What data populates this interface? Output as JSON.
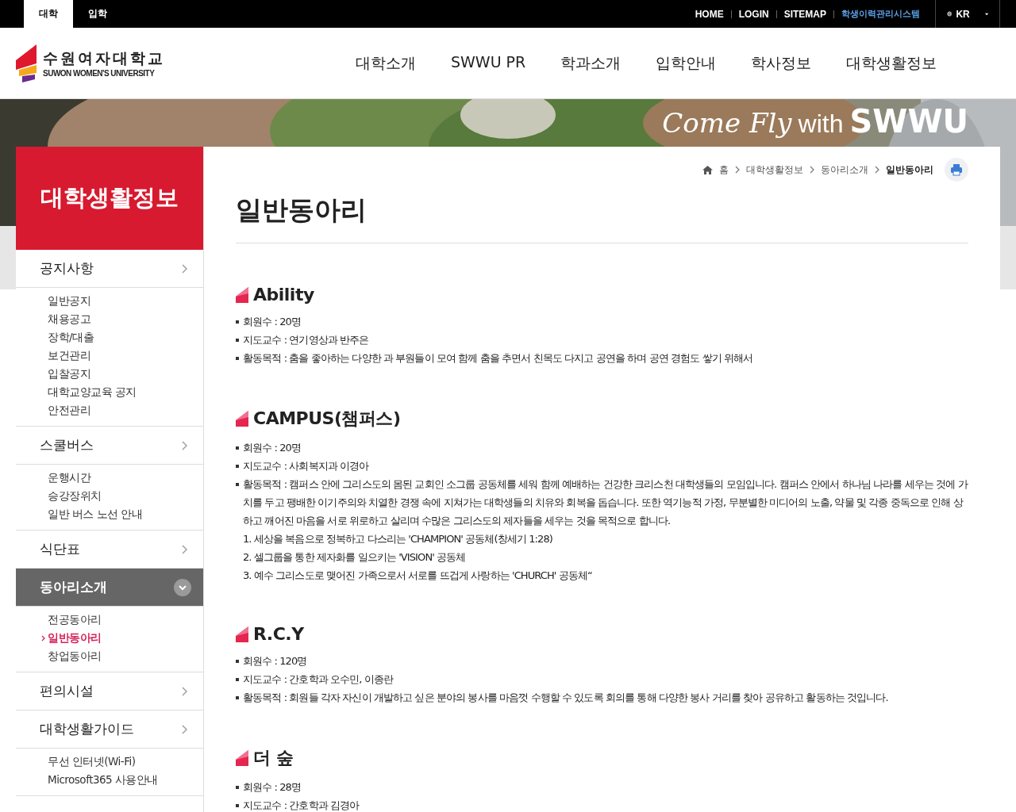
{
  "top_bar": {
    "site_tabs": [
      {
        "label": "대학",
        "selected": true
      },
      {
        "label": "입학",
        "selected": false
      }
    ],
    "links": [
      {
        "label": "HOME",
        "kind": "plain"
      },
      {
        "label": "LOGIN",
        "kind": "plain"
      },
      {
        "label": "SITEMAP",
        "kind": "plain"
      },
      {
        "label": "학생이력관리시스템",
        "kind": "highlight"
      }
    ],
    "language": "KR"
  },
  "header": {
    "logo_korean": "수원여자대학교",
    "logo_english": "SUWON WOMEN'S UNIVERSITY",
    "nav": [
      "대학소개",
      "SWWU PR",
      "학과소개",
      "입학안내",
      "학사정보",
      "대학생활정보"
    ]
  },
  "banner": {
    "slogan_script": "Come Fly",
    "slogan_with": "with",
    "slogan_bold": "SWWU"
  },
  "sidebar": {
    "title": "대학생활정보",
    "groups": [
      {
        "label": "공지사항",
        "selected": false,
        "children": [
          {
            "label": "일반공지",
            "selected": false
          },
          {
            "label": "채용공고",
            "selected": false
          },
          {
            "label": "장학/대출",
            "selected": false
          },
          {
            "label": "보건관리",
            "selected": false
          },
          {
            "label": "입찰공지",
            "selected": false
          },
          {
            "label": "대학교양교육 공지",
            "selected": false
          },
          {
            "label": "안전관리",
            "selected": false
          }
        ]
      },
      {
        "label": "스쿨버스",
        "selected": false,
        "children": [
          {
            "label": "운행시간",
            "selected": false
          },
          {
            "label": "승강장위치",
            "selected": false
          },
          {
            "label": "일반 버스 노선 안내",
            "selected": false
          }
        ]
      },
      {
        "label": "식단표",
        "selected": false
      },
      {
        "label": "동아리소개",
        "selected": true,
        "children": [
          {
            "label": "전공동아리",
            "selected": false
          },
          {
            "label": "일반동아리",
            "selected": true
          },
          {
            "label": "창업동아리",
            "selected": false
          }
        ]
      },
      {
        "label": "편의시설",
        "selected": false
      },
      {
        "label": "대학생활가이드",
        "selected": false,
        "children": [
          {
            "label": "무선 인터넷(Wi-Fi)",
            "selected": false
          },
          {
            "label": "Microsoft365 사용안내",
            "selected": false
          }
        ]
      }
    ]
  },
  "breadcrumb": [
    "홈",
    "대학생활정보",
    "동아리소개",
    "일반동아리"
  ],
  "page_title": "일반동아리",
  "clubs": [
    {
      "name": "Ability",
      "items": [
        {
          "text": "회원수 : 20명"
        },
        {
          "text": "지도교수 : 연기영상과 반주은"
        },
        {
          "text": "활동목적 : 춤을 좋아하는 다양한 과 부원들이 모여 함께 춤을 추면서 친목도 다지고 공연을 하며 공연 경험도 쌓기 위해서"
        }
      ]
    },
    {
      "name": "CAMPUS(챔퍼스)",
      "items": [
        {
          "text": "회원수 : 20명"
        },
        {
          "text": "지도교수 : 사회복지과 이경아"
        },
        {
          "text": "활동목적 : 캠퍼스 안에 그리스도의 몸된 교회인 소그룹 공동체를 세워 함께 예배하는 건강한 크리스천 대학생들의 모임입니다. 캠퍼스 안에서 하나님 나라를 세우는 것에 가치를 두고 팽배한 이기주의와 치열한 경쟁 속에 지쳐가는 대학생들의 치유와 회복을 돕습니다. 또한 역기능적 가정, 무분별한 미디어의 노출, 약물 및 각종 중독으로 인해 상하고 깨어진 마음을 서로 위로하고 살리며 수많은 그리스도의 제자들을 세우는 것을 목적으로 합니다.",
          "lines": [
            "1. 세상을 복음으로 정복하고 다스리는 'CHAMPION' 공동체(창세기 1:28)",
            "2. 셀그룹을 통한 제자화를 일으키는 'VISION' 공동체",
            "3. 예수 그리스도로 맺어진 가족으로서 서로를 뜨겁게 사랑하는 'CHURCH' 공동체“"
          ]
        }
      ]
    },
    {
      "name": "R.C.Y",
      "items": [
        {
          "text": "회원수 : 120명"
        },
        {
          "text": "지도교수 : 간호학과 오수민, 이종란"
        },
        {
          "text": "활동목적 : 회원들 각자 자신이 개발하고 싶은 분야의 봉사를 마음껏 수행할 수 있도록 회의를 통해 다양한 봉사 거리를 찾아 공유하고 활동하는 것입니다."
        }
      ]
    },
    {
      "name": "더 숲",
      "items": [
        {
          "text": "회원수 : 28명"
        },
        {
          "text": "지도교수 : 간호학과 김경아"
        }
      ]
    }
  ]
}
